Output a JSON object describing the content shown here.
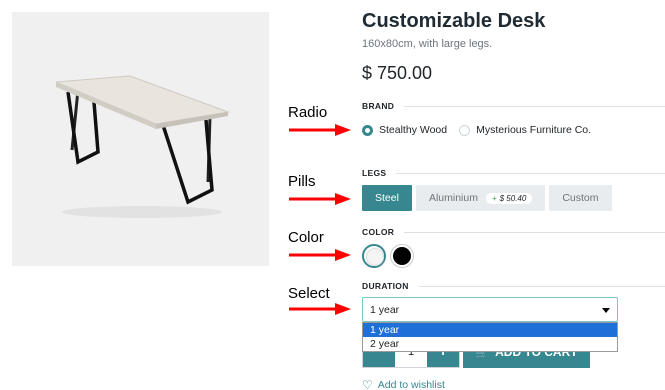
{
  "annotations": {
    "radio": "Radio",
    "pills": "Pills",
    "color": "Color",
    "select": "Select"
  },
  "product": {
    "title": "Customizable Desk",
    "subtitle": "160x80cm, with large legs.",
    "price": "$ 750.00"
  },
  "brand": {
    "heading": "BRAND",
    "options": [
      "Stealthy Wood",
      "Mysterious Furniture Co."
    ],
    "selected": "Stealthy Wood"
  },
  "legs": {
    "heading": "LEGS",
    "options": [
      "Steel",
      "Aluminium",
      "Custom"
    ],
    "selected": "Steel",
    "aluminium_extra": "$ 50.40"
  },
  "color": {
    "heading": "COLOR",
    "swatches": [
      "#ffffff",
      "#000000"
    ],
    "selected": "#ffffff"
  },
  "duration": {
    "heading": "DURATION",
    "value": "1 year",
    "options": [
      "1 year",
      "2 year"
    ]
  },
  "cart": {
    "quantity": "1",
    "add_label": "ADD TO CART",
    "minus": "−",
    "plus": "+"
  },
  "wishlist": {
    "label": "Add to wishlist"
  },
  "colors": {
    "accent": "#36878f",
    "arrow": "#ff0000",
    "highlight": "#1f6fd9"
  }
}
